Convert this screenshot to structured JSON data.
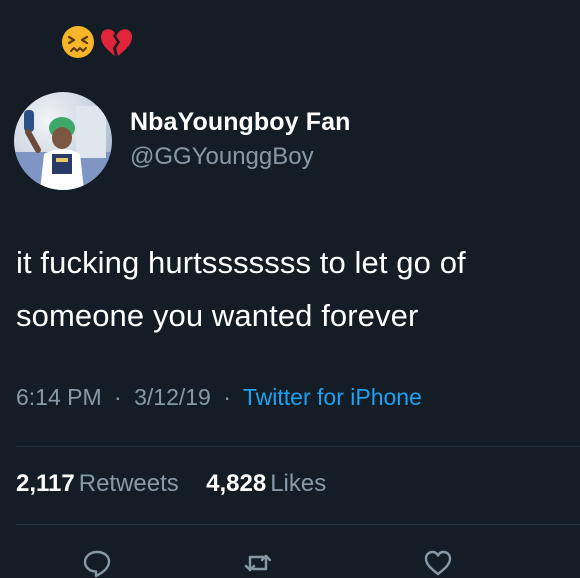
{
  "status_emojis": [
    "confounded-face",
    "broken-heart"
  ],
  "author": {
    "display_name": "NbaYoungboy Fan",
    "handle": "@GGYounggBoy"
  },
  "tweet": {
    "text_line1": "it fucking hurtsssssss to let go of",
    "text_line2": "someone you wanted forever"
  },
  "meta": {
    "time": "6:14 PM",
    "separator": "·",
    "date": "3/12/19",
    "source": "Twitter for iPhone"
  },
  "stats": {
    "retweets_count": "2,117",
    "retweets_label": "Retweets",
    "likes_count": "4,828",
    "likes_label": "Likes"
  },
  "actions": [
    "reply-icon",
    "retweet-icon",
    "like-icon"
  ],
  "colors": {
    "background": "#141d26",
    "text": "#ffffff",
    "secondary": "#8899a6",
    "link": "#1da1f2",
    "divider": "#253341"
  }
}
